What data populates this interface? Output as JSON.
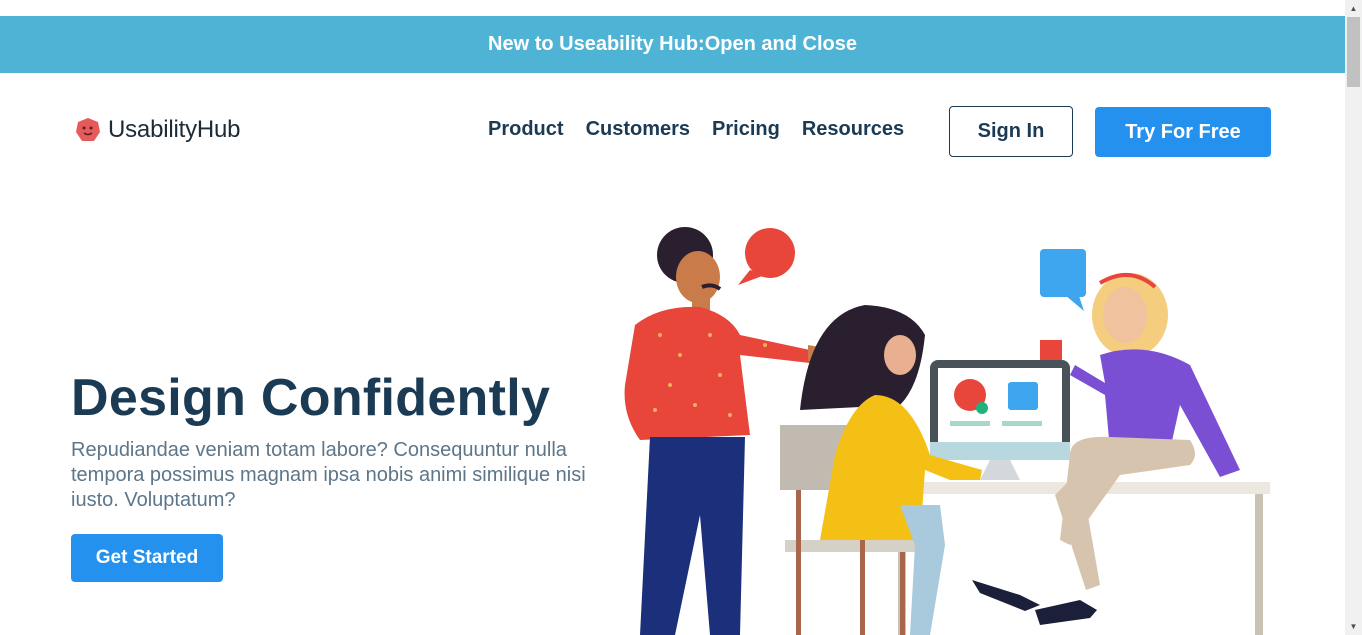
{
  "banner": {
    "text": "New to Useability Hub:Open and Close"
  },
  "logo": {
    "text": "UsabilityHub"
  },
  "nav": {
    "items": [
      "Product",
      "Customers",
      "Pricing",
      "Resources"
    ],
    "sign_in": "Sign In",
    "try_free": "Try For Free"
  },
  "hero": {
    "title": "Design Confidently",
    "text": "Repudiandae veniam totam labore? Consequuntur nulla tempora possimus magnam ipsa nobis animi similique nisi iusto. Voluptatum?",
    "cta": "Get Started"
  },
  "colors": {
    "banner": "#4fb3d5",
    "primary": "#2591ee",
    "heading": "#1b3a54",
    "body_text": "#5d7689"
  },
  "icons": {
    "logo": "hub-blob-icon",
    "scroll_up": "scroll-up-arrow-icon",
    "scroll_down": "scroll-down-arrow-icon"
  }
}
